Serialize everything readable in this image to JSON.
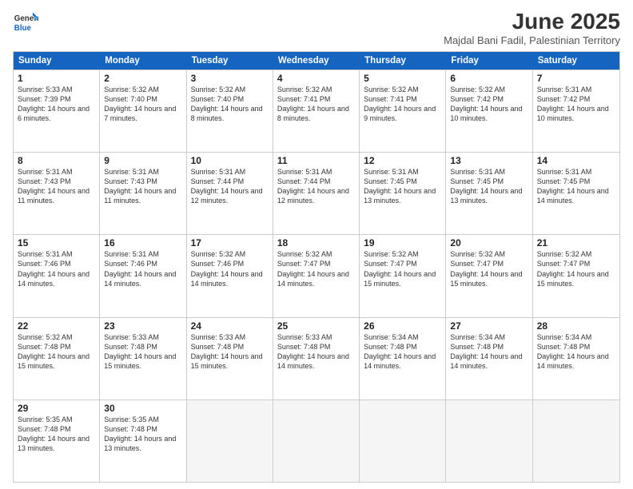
{
  "logo": {
    "general": "General",
    "blue": "Blue"
  },
  "title": "June 2025",
  "subtitle": "Majdal Bani Fadil, Palestinian Territory",
  "header_days": [
    "Sunday",
    "Monday",
    "Tuesday",
    "Wednesday",
    "Thursday",
    "Friday",
    "Saturday"
  ],
  "weeks": [
    [
      {
        "day": 1,
        "sunrise": "5:33 AM",
        "sunset": "7:39 PM",
        "daylight": "14 hours and 6 minutes."
      },
      {
        "day": 2,
        "sunrise": "5:32 AM",
        "sunset": "7:40 PM",
        "daylight": "14 hours and 7 minutes."
      },
      {
        "day": 3,
        "sunrise": "5:32 AM",
        "sunset": "7:40 PM",
        "daylight": "14 hours and 8 minutes."
      },
      {
        "day": 4,
        "sunrise": "5:32 AM",
        "sunset": "7:41 PM",
        "daylight": "14 hours and 8 minutes."
      },
      {
        "day": 5,
        "sunrise": "5:32 AM",
        "sunset": "7:41 PM",
        "daylight": "14 hours and 9 minutes."
      },
      {
        "day": 6,
        "sunrise": "5:32 AM",
        "sunset": "7:42 PM",
        "daylight": "14 hours and 10 minutes."
      },
      {
        "day": 7,
        "sunrise": "5:31 AM",
        "sunset": "7:42 PM",
        "daylight": "14 hours and 10 minutes."
      }
    ],
    [
      {
        "day": 8,
        "sunrise": "5:31 AM",
        "sunset": "7:43 PM",
        "daylight": "14 hours and 11 minutes."
      },
      {
        "day": 9,
        "sunrise": "5:31 AM",
        "sunset": "7:43 PM",
        "daylight": "14 hours and 11 minutes."
      },
      {
        "day": 10,
        "sunrise": "5:31 AM",
        "sunset": "7:44 PM",
        "daylight": "14 hours and 12 minutes."
      },
      {
        "day": 11,
        "sunrise": "5:31 AM",
        "sunset": "7:44 PM",
        "daylight": "14 hours and 12 minutes."
      },
      {
        "day": 12,
        "sunrise": "5:31 AM",
        "sunset": "7:45 PM",
        "daylight": "14 hours and 13 minutes."
      },
      {
        "day": 13,
        "sunrise": "5:31 AM",
        "sunset": "7:45 PM",
        "daylight": "14 hours and 13 minutes."
      },
      {
        "day": 14,
        "sunrise": "5:31 AM",
        "sunset": "7:45 PM",
        "daylight": "14 hours and 14 minutes."
      }
    ],
    [
      {
        "day": 15,
        "sunrise": "5:31 AM",
        "sunset": "7:46 PM",
        "daylight": "14 hours and 14 minutes."
      },
      {
        "day": 16,
        "sunrise": "5:31 AM",
        "sunset": "7:46 PM",
        "daylight": "14 hours and 14 minutes."
      },
      {
        "day": 17,
        "sunrise": "5:32 AM",
        "sunset": "7:46 PM",
        "daylight": "14 hours and 14 minutes."
      },
      {
        "day": 18,
        "sunrise": "5:32 AM",
        "sunset": "7:47 PM",
        "daylight": "14 hours and 14 minutes."
      },
      {
        "day": 19,
        "sunrise": "5:32 AM",
        "sunset": "7:47 PM",
        "daylight": "14 hours and 15 minutes."
      },
      {
        "day": 20,
        "sunrise": "5:32 AM",
        "sunset": "7:47 PM",
        "daylight": "14 hours and 15 minutes."
      },
      {
        "day": 21,
        "sunrise": "5:32 AM",
        "sunset": "7:47 PM",
        "daylight": "14 hours and 15 minutes."
      }
    ],
    [
      {
        "day": 22,
        "sunrise": "5:32 AM",
        "sunset": "7:48 PM",
        "daylight": "14 hours and 15 minutes."
      },
      {
        "day": 23,
        "sunrise": "5:33 AM",
        "sunset": "7:48 PM",
        "daylight": "14 hours and 15 minutes."
      },
      {
        "day": 24,
        "sunrise": "5:33 AM",
        "sunset": "7:48 PM",
        "daylight": "14 hours and 15 minutes."
      },
      {
        "day": 25,
        "sunrise": "5:33 AM",
        "sunset": "7:48 PM",
        "daylight": "14 hours and 14 minutes."
      },
      {
        "day": 26,
        "sunrise": "5:34 AM",
        "sunset": "7:48 PM",
        "daylight": "14 hours and 14 minutes."
      },
      {
        "day": 27,
        "sunrise": "5:34 AM",
        "sunset": "7:48 PM",
        "daylight": "14 hours and 14 minutes."
      },
      {
        "day": 28,
        "sunrise": "5:34 AM",
        "sunset": "7:48 PM",
        "daylight": "14 hours and 14 minutes."
      }
    ],
    [
      {
        "day": 29,
        "sunrise": "5:35 AM",
        "sunset": "7:48 PM",
        "daylight": "14 hours and 13 minutes."
      },
      {
        "day": 30,
        "sunrise": "5:35 AM",
        "sunset": "7:48 PM",
        "daylight": "14 hours and 13 minutes."
      },
      null,
      null,
      null,
      null,
      null
    ]
  ]
}
